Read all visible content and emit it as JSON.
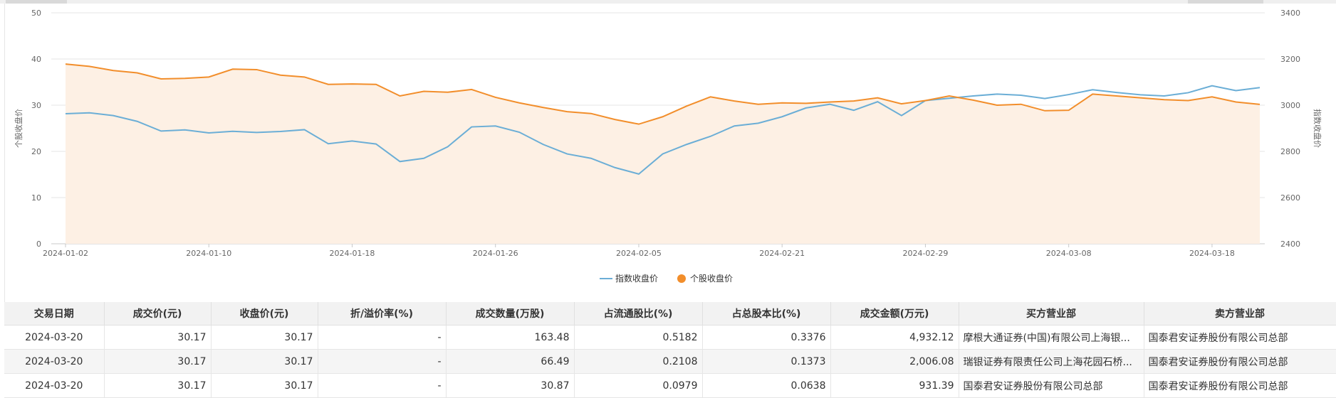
{
  "chart_data": {
    "type": "line",
    "ylabel": "个股收盘价",
    "y2label": "指数收盘价",
    "ylim": [
      0,
      50
    ],
    "y2lim": [
      2400,
      3400
    ],
    "yticks": [
      0,
      10,
      20,
      30,
      40,
      50
    ],
    "y2ticks": [
      2400,
      2600,
      2800,
      3000,
      3200,
      3400
    ],
    "xtick_labels": [
      "2024-01-02",
      "2024-01-10",
      "2024-01-18",
      "2024-01-26",
      "2024-02-05",
      "2024-02-21",
      "2024-02-29",
      "2024-03-08",
      "2024-03-18"
    ],
    "xtick_dates": [
      "2024-01-02",
      "2024-01-10",
      "2024-01-18",
      "2024-01-26",
      "2024-02-05",
      "2024-02-21",
      "2024-02-29",
      "2024-03-08",
      "2024-03-18"
    ],
    "legend_position": "bottom-center",
    "grid": true,
    "x": [
      "2024-01-02",
      "2024-01-03",
      "2024-01-04",
      "2024-01-05",
      "2024-01-08",
      "2024-01-09",
      "2024-01-10",
      "2024-01-11",
      "2024-01-12",
      "2024-01-15",
      "2024-01-16",
      "2024-01-17",
      "2024-01-18",
      "2024-01-19",
      "2024-01-22",
      "2024-01-23",
      "2024-01-24",
      "2024-01-25",
      "2024-01-26",
      "2024-01-29",
      "2024-01-30",
      "2024-01-31",
      "2024-02-01",
      "2024-02-02",
      "2024-02-05",
      "2024-02-06",
      "2024-02-07",
      "2024-02-08",
      "2024-02-19",
      "2024-02-20",
      "2024-02-21",
      "2024-02-22",
      "2024-02-23",
      "2024-02-26",
      "2024-02-27",
      "2024-02-28",
      "2024-02-29",
      "2024-03-01",
      "2024-03-04",
      "2024-03-05",
      "2024-03-06",
      "2024-03-07",
      "2024-03-08",
      "2024-03-11",
      "2024-03-12",
      "2024-03-13",
      "2024-03-14",
      "2024-03-15",
      "2024-03-18",
      "2024-03-19",
      "2024-03-20"
    ],
    "series": [
      {
        "name": "指数收盘价",
        "axis": "right",
        "color": "#6baed6",
        "values": [
          2963,
          2967,
          2955,
          2930,
          2888,
          2893,
          2880,
          2887,
          2882,
          2886,
          2894,
          2833,
          2845,
          2832,
          2756,
          2770,
          2820,
          2906,
          2910,
          2883,
          2830,
          2789,
          2770,
          2730,
          2702,
          2789,
          2830,
          2865,
          2910,
          2922,
          2950,
          2988,
          3004,
          2978,
          3015,
          2955,
          3020,
          3030,
          3040,
          3048,
          3043,
          3029,
          3046,
          3067,
          3055,
          3045,
          3040,
          3054,
          3084,
          3063,
          3076
        ]
      },
      {
        "name": "个股收盘价",
        "axis": "left",
        "color": "#f28e2b",
        "values": [
          38.9,
          38.4,
          37.5,
          37.0,
          35.7,
          35.8,
          36.1,
          37.8,
          37.7,
          36.5,
          36.1,
          34.5,
          34.6,
          34.5,
          32.0,
          33.0,
          32.8,
          33.4,
          31.7,
          30.5,
          29.5,
          28.6,
          28.2,
          26.9,
          25.9,
          27.5,
          29.8,
          31.8,
          30.9,
          30.2,
          30.5,
          30.4,
          30.7,
          30.9,
          31.6,
          30.3,
          31.0,
          32.0,
          31.1,
          30.0,
          30.2,
          28.8,
          28.9,
          32.4,
          32.0,
          31.6,
          31.2,
          31.0,
          31.8,
          30.7,
          30.17
        ]
      }
    ]
  },
  "table": {
    "headers": [
      "交易日期",
      "成交价(元)",
      "收盘价(元)",
      "折/溢价率(%)",
      "成交数量(万股)",
      "占流通股比(%)",
      "占总股本比(%)",
      "成交金额(万元)",
      "买方营业部",
      "卖方营业部"
    ],
    "rows": [
      [
        "2024-03-20",
        "30.17",
        "30.17",
        "-",
        "163.48",
        "0.5182",
        "0.3376",
        "4,932.12",
        "摩根大通证券(中国)有限公司上海银...",
        "国泰君安证券股份有限公司总部"
      ],
      [
        "2024-03-20",
        "30.17",
        "30.17",
        "-",
        "66.49",
        "0.2108",
        "0.1373",
        "2,006.08",
        "瑞银证券有限责任公司上海花园石桥...",
        "国泰君安证券股份有限公司总部"
      ],
      [
        "2024-03-20",
        "30.17",
        "30.17",
        "-",
        "30.87",
        "0.0979",
        "0.0638",
        "931.39",
        "国泰君安证券股份有限公司总部",
        "国泰君安证券股份有限公司总部"
      ]
    ]
  }
}
